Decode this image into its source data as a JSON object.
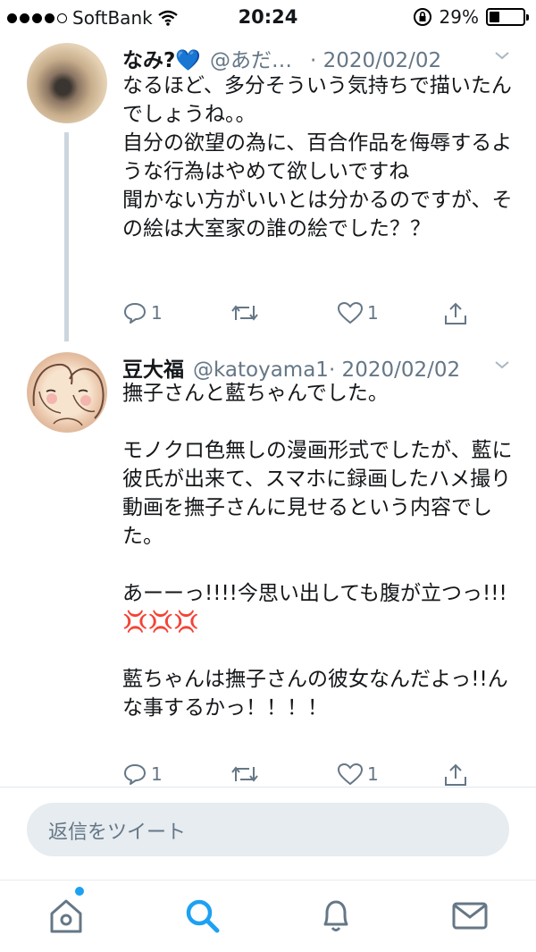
{
  "status_bar": {
    "carrier": "SoftBank",
    "time": "20:24",
    "battery": "29%"
  },
  "tweets": [
    {
      "name": "なみ?💙",
      "handle": "@あだ…",
      "date": "· 2020/02/02",
      "text": "なるほど、多分そういう気持ちで描いたんでしょうね。。\n自分の欲望の為に、百合作品を侮辱するような行為はやめて欲しいですね\n聞かない方がいいとは分かるのですが、その絵は大室家の誰の絵でした？？",
      "reply_count": "1",
      "like_count": "1"
    },
    {
      "name": "豆大福",
      "handle": "@katoyama1",
      "date": "· 2020/02/02",
      "text": "撫子さんと藍ちゃんでした。\n\nモノクロ色無しの漫画形式でしたが、藍に彼氏が出来て、スマホに録画したハメ撮り動画を撫子さんに見せるという内容でした。\n\nあーーっ!!!!今思い出しても腹が立つっ!!!💢💢💢\n\n藍ちゃんは撫子さんの彼女なんだよっ!!んな事するかっ！！！！",
      "reply_count": "1",
      "like_count": "1"
    }
  ],
  "reply_bar": {
    "placeholder": "返信をツイート"
  },
  "tab_bar": {
    "icons": [
      "home-icon",
      "search-icon",
      "notifications-icon",
      "messages-icon"
    ],
    "active": "search-icon",
    "accent_color": "#1da1f2"
  }
}
